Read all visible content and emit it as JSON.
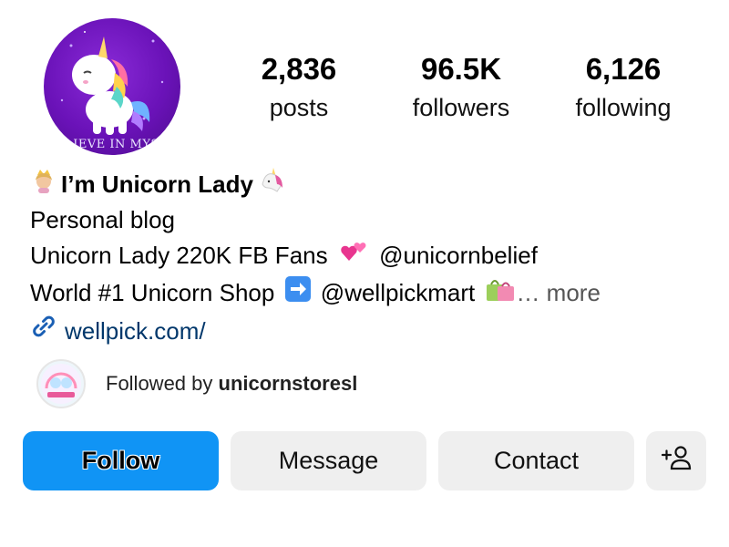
{
  "profile": {
    "avatar_caption": "ELIEVE IN MYSE",
    "stats": [
      {
        "value": "2,836",
        "label": "posts"
      },
      {
        "value": "96.5K",
        "label": "followers"
      },
      {
        "value": "6,126",
        "label": "following"
      }
    ],
    "name": "I’m Unicorn Lady",
    "category": "Personal blog",
    "bio_line1_text": "Unicorn Lady 220K FB Fans",
    "bio_line1_mention": "@unicornbelief",
    "bio_line2_text": "World #1 Unicorn Shop",
    "bio_line2_mention": "@wellpickmart",
    "bio_more": "… more",
    "link": "wellpick.com/",
    "followed_by_prefix": "Followed by",
    "followed_by_user": "unicornstoresl"
  },
  "actions": {
    "follow_label": "Follow",
    "message_label": "Message",
    "contact_label": "Contact",
    "add_person_icon": "add-person-icon"
  },
  "colors": {
    "follow_button": "#1094f5",
    "secondary_button": "#efefef",
    "link": "#00376b"
  }
}
